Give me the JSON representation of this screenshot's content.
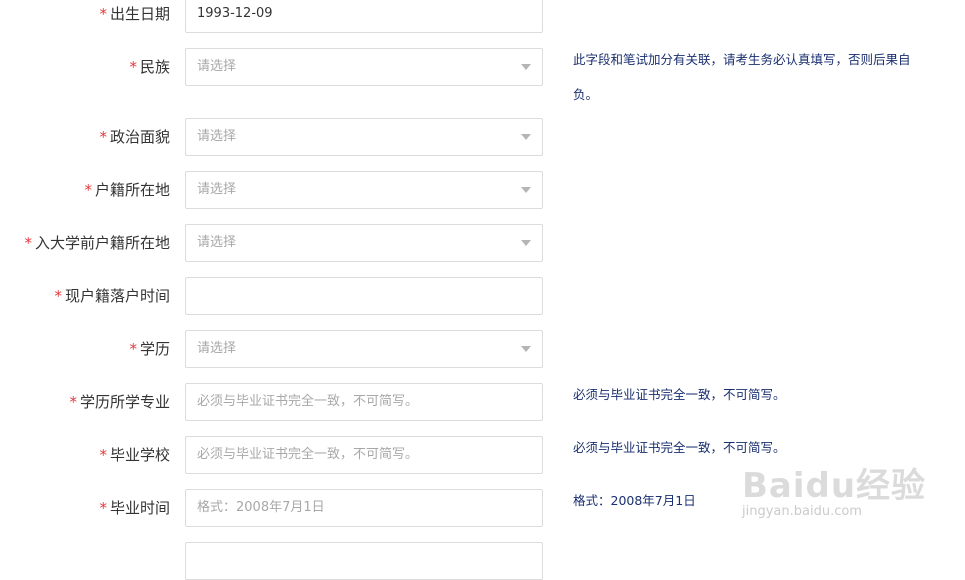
{
  "rows": [
    {
      "label": "出生日期",
      "required": "*",
      "value": "1993-12-09",
      "placeholder": "",
      "hint": ""
    },
    {
      "label": "民族",
      "required": "*",
      "value": "",
      "placeholder": "请选择",
      "hint": "此字段和笔试加分有关联，请考生务必认真填写，否则后果自",
      "hint2": "负。"
    },
    {
      "label": "政治面貌",
      "required": "*",
      "value": "",
      "placeholder": "请选择",
      "hint": ""
    },
    {
      "label": "户籍所在地",
      "required": "*",
      "value": "",
      "placeholder": "请选择",
      "hint": ""
    },
    {
      "label": "入大学前户籍所在地",
      "required": "*",
      "value": "",
      "placeholder": "请选择",
      "hint": ""
    },
    {
      "label": "现户籍落户时间",
      "required": "*",
      "value": "",
      "placeholder": "",
      "hint": ""
    },
    {
      "label": "学历",
      "required": "*",
      "value": "",
      "placeholder": "请选择",
      "hint": ""
    },
    {
      "label": "学历所学专业",
      "required": "*",
      "value": "",
      "placeholder": "必须与毕业证书完全一致，不可简写。",
      "hint": "必须与毕业证书完全一致，不可简写。"
    },
    {
      "label": "毕业学校",
      "required": "*",
      "value": "",
      "placeholder": "必须与毕业证书完全一致，不可简写。",
      "hint": "必须与毕业证书完全一致，不可简写。"
    },
    {
      "label": "毕业时间",
      "required": "*",
      "value": "",
      "placeholder": "格式：2008年7月1日",
      "hint": "格式：2008年7月1日"
    }
  ],
  "watermark": {
    "brand": "Baidu经验",
    "url": "jingyan.baidu.com"
  },
  "colors": {
    "required": "#e4393c",
    "hint": "#1a2f6f",
    "border": "#dcdcdc",
    "placeholder": "#a8a8a8"
  }
}
